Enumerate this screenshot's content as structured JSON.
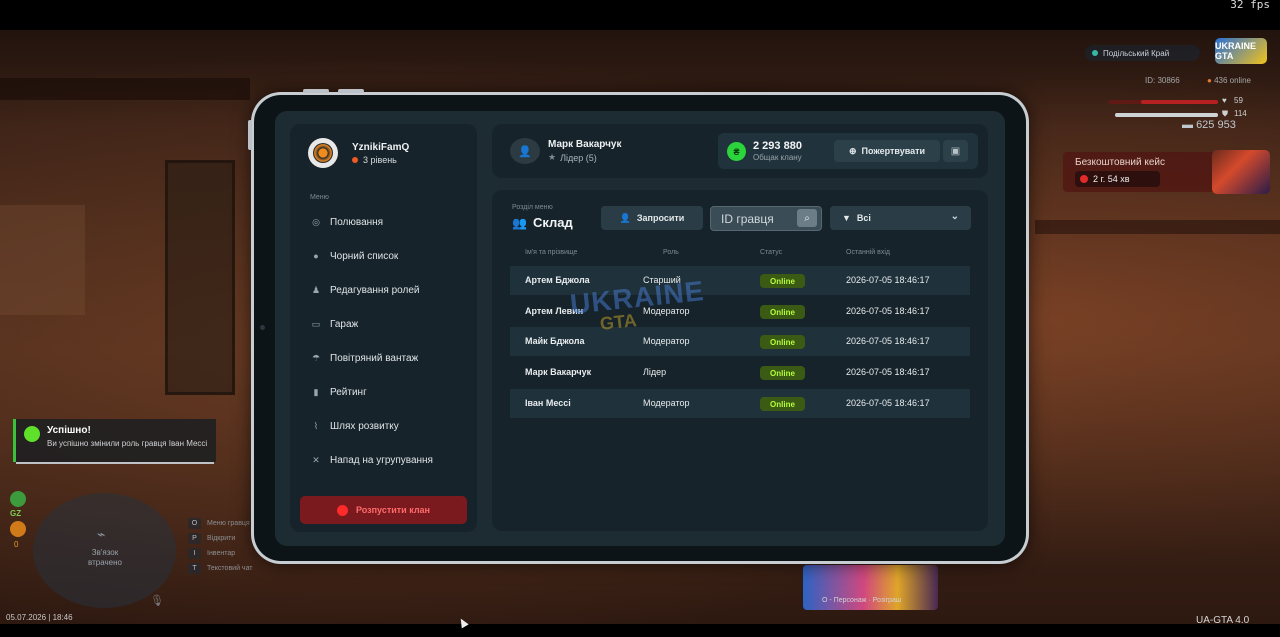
{
  "hud": {
    "fps": "32 fps",
    "server_name": "Подільський Край",
    "logo_text": "UKRAINE GTA",
    "player_id": "ID: 30866",
    "online": "436 online",
    "hp_value": "59",
    "armor_value": "114",
    "money": "625 953",
    "case_title": "Безкоштовний кейс",
    "case_timer": "2 г. 54 хв",
    "gz_label": "GZ",
    "gz_count": "0",
    "radar_text": "Зв'язок втрачено",
    "keys": [
      {
        "key": "O",
        "label": "Меню гравця"
      },
      {
        "key": "P",
        "label": "Відкрити"
      },
      {
        "key": "I",
        "label": "Інвентар"
      },
      {
        "key": "T",
        "label": "Текстовий чат"
      }
    ],
    "datetime": "05.07.2026 | 18:46",
    "version": "UA-GTA 4.0",
    "character_hint": "О - Персонаж · Розіграш"
  },
  "notification": {
    "title": "Успішно!",
    "text": "Ви успішно змінили роль гравця Іван Мессі"
  },
  "sidebar": {
    "family_name": "YznikiFamQ",
    "family_level": "3 рівень",
    "menu_caption": "Меню",
    "items": [
      {
        "label": "Полювання",
        "icon": "target-icon"
      },
      {
        "label": "Чорний список",
        "icon": "block-icon"
      },
      {
        "label": "Редагування ролей",
        "icon": "user-edit-icon"
      },
      {
        "label": "Гараж",
        "icon": "car-icon"
      },
      {
        "label": "Повітряний вантаж",
        "icon": "parachute-icon"
      },
      {
        "label": "Рейтинг",
        "icon": "chart-icon"
      },
      {
        "label": "Шлях розвитку",
        "icon": "path-icon"
      },
      {
        "label": "Напад на угрупування",
        "icon": "swords-icon"
      }
    ],
    "disband_label": "Розпустити клан"
  },
  "header": {
    "user_name": "Марк Вакарчук",
    "user_role": "Лідер (5)",
    "bank_amount": "2 293 880",
    "bank_label": "Общак клану",
    "donate_label": "Пожертвувати"
  },
  "section": {
    "caption": "Розділ меню",
    "title": "Склад",
    "invite_label": "Запросити",
    "id_placeholder": "ID гравця",
    "filter_value": "Всі",
    "columns": [
      "Ім'я та прізвище",
      "Роль",
      "Статус",
      "Останній вхід"
    ],
    "rows": [
      {
        "name": "Артем Бджола",
        "role": "Старший",
        "status": "Online",
        "last": "2026-07-05 18:46:17"
      },
      {
        "name": "Артем Левин",
        "role": "Модератор",
        "status": "Online",
        "last": "2026-07-05 18:46:17"
      },
      {
        "name": "Майк Бджола",
        "role": "Модератор",
        "status": "Online",
        "last": "2026-07-05 18:46:17"
      },
      {
        "name": "Марк Вакарчук",
        "role": "Лідер",
        "status": "Online",
        "last": "2026-07-05 18:46:17"
      },
      {
        "name": "Іван Мессі",
        "role": "Модератор",
        "status": "Online",
        "last": "2026-07-05 18:46:17"
      }
    ]
  },
  "colors": {
    "accent_green": "#2bd43a",
    "online_text": "#b5ff3a",
    "danger": "#ff2a2a",
    "panel": "#16232a"
  }
}
